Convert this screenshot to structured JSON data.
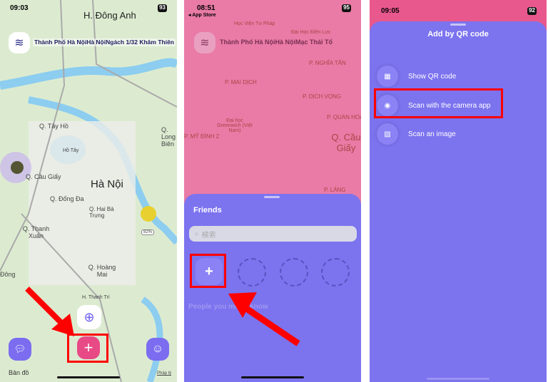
{
  "panel1": {
    "status": {
      "time": "09:03",
      "battery": "93"
    },
    "address": "Thành Phố Hà NộiHà NộiNgách 1/32 Khâm Thiên",
    "map_labels": [
      "H. Đông Anh",
      "Q. Tây Hồ",
      "Hồ Tây",
      "Q. Cầu Giấy",
      "Hà Nội",
      "Q. Đống Đa",
      "Q. Hai Bà Trưng",
      "Q. Thanh Xuân",
      "Q. Hoàng Mai",
      "Q. Long Biên",
      "H. Thanh Trì",
      "Đông"
    ],
    "battery_badge": "82%",
    "attribution": "Bản đồ",
    "legal": "Pháp lý",
    "icons": {
      "layers": "layers-icon",
      "locate": "locate-icon",
      "add": "plus-icon",
      "chat": "chat-icon",
      "smile": "smile-icon"
    },
    "colors": {
      "map": "#dcebd0",
      "water": "#8ccdf0",
      "add": "#e84a86",
      "accent": "#7b6cf0"
    }
  },
  "panel2": {
    "status": {
      "time": "08:51",
      "back": "◂ App Store",
      "battery": "95"
    },
    "address": "Thành Phố Hà NộiHà NộiMạc Thái Tổ",
    "map_labels": [
      "Học Viện Tư Pháp",
      "Đại Học Điện Lực",
      "P. MAI DỊCH",
      "P. DỊCH VỌNG",
      "P. NGHĨA TÂN",
      "P. QUAN HOA",
      "P. MỸ ĐÌNH 2",
      "Q. Cầu Giấy",
      "P. LÁNG",
      "Đại học Greenwich (Việt Nam)"
    ],
    "sheet": {
      "title": "Friends",
      "search_placeholder": "検索",
      "section": "People you might know"
    },
    "colors": {
      "overlay": "#e97ba6",
      "sheet": "#7c73ef"
    }
  },
  "panel3": {
    "status": {
      "time": "09:05",
      "battery": "92"
    },
    "title": "Add by QR code",
    "items": [
      {
        "label": "Show QR code",
        "icon": "qr-code-icon"
      },
      {
        "label": "Scan with the camera app",
        "icon": "camera-icon"
      },
      {
        "label": "Scan an image",
        "icon": "image-icon"
      }
    ],
    "colors": {
      "top": "#e8588c",
      "sheet": "#7c73ef"
    }
  }
}
